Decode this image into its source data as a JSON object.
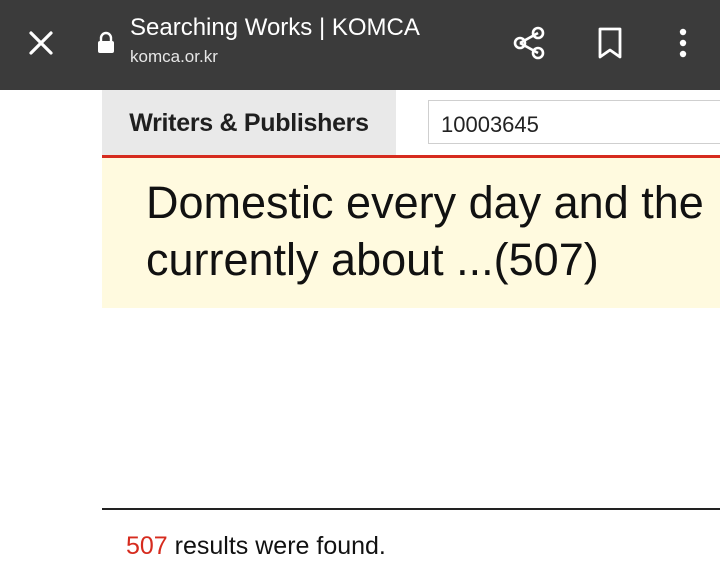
{
  "browser": {
    "title": "Searching Works | KOMCA",
    "url": "komca.or.kr",
    "icons": {
      "close": "close-icon",
      "lock": "lock-icon",
      "share": "share-icon",
      "bookmark": "bookmark-icon",
      "more": "more-vert-icon"
    }
  },
  "search": {
    "category_label": "Writers & Publishers",
    "query_value": "10003645"
  },
  "banner": {
    "line1": "Domestic every day and the",
    "line2": "currently about ...(507)"
  },
  "results": {
    "count": "507",
    "suffix": " results were found."
  },
  "colors": {
    "toolbar": "#3b3b3b",
    "accent_red": "#d62b1e",
    "banner_bg": "#fffadf",
    "tab_bg": "#e9e9e9"
  }
}
